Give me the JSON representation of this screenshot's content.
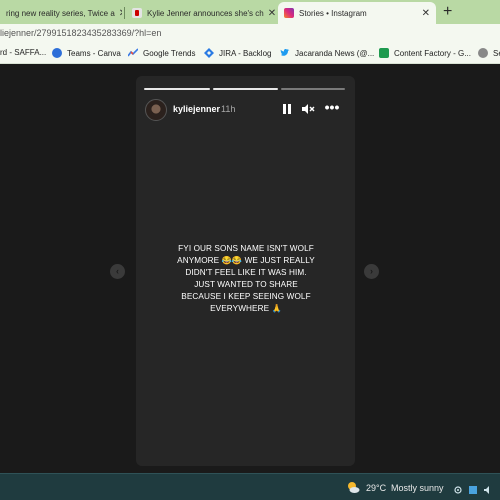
{
  "browser": {
    "tabs": [
      {
        "title": "ring new reality series, Twice a",
        "active": false
      },
      {
        "title": "Kylie Jenner announces she's ch",
        "active": false
      },
      {
        "title": "Stories • Instagram",
        "active": true
      }
    ],
    "url": "liejenner/2799151823435283369/?hl=en",
    "bookmarks": [
      {
        "label": "rd - SAFFA...",
        "icon": "bookmark-icon"
      },
      {
        "label": "Teams - Canva",
        "icon": "canva-icon"
      },
      {
        "label": "Google Trends",
        "icon": "trends-icon"
      },
      {
        "label": "JIRA - Backlog",
        "icon": "jira-icon"
      },
      {
        "label": "Jacaranda News (@...",
        "icon": "twitter-icon"
      },
      {
        "label": "Content Factory - G...",
        "icon": "sheets-icon"
      },
      {
        "label": "Se",
        "icon": "generic-icon"
      }
    ]
  },
  "story": {
    "username": "kyliejenner",
    "time": "11h",
    "caption": "FYI OUR SONS NAME ISN'T WOLF ANYMORE 😂😂 WE JUST REALLY DIDN'T FEEL LIKE IT WAS HIM. JUST WANTED TO SHARE BECAUSE I KEEP SEEING WOLF EVERYWHERE 🙏",
    "progress_segments": 3,
    "current_segment": 2
  },
  "taskbar": {
    "temperature": "29°C",
    "condition": "Mostly sunny"
  },
  "colors": {
    "tabstrip": "#b9d9a4",
    "toolbar": "#f4f8f0",
    "page_background": "#1a1a1a",
    "story_background": "#262626",
    "taskbar": "#1f3b3f"
  }
}
